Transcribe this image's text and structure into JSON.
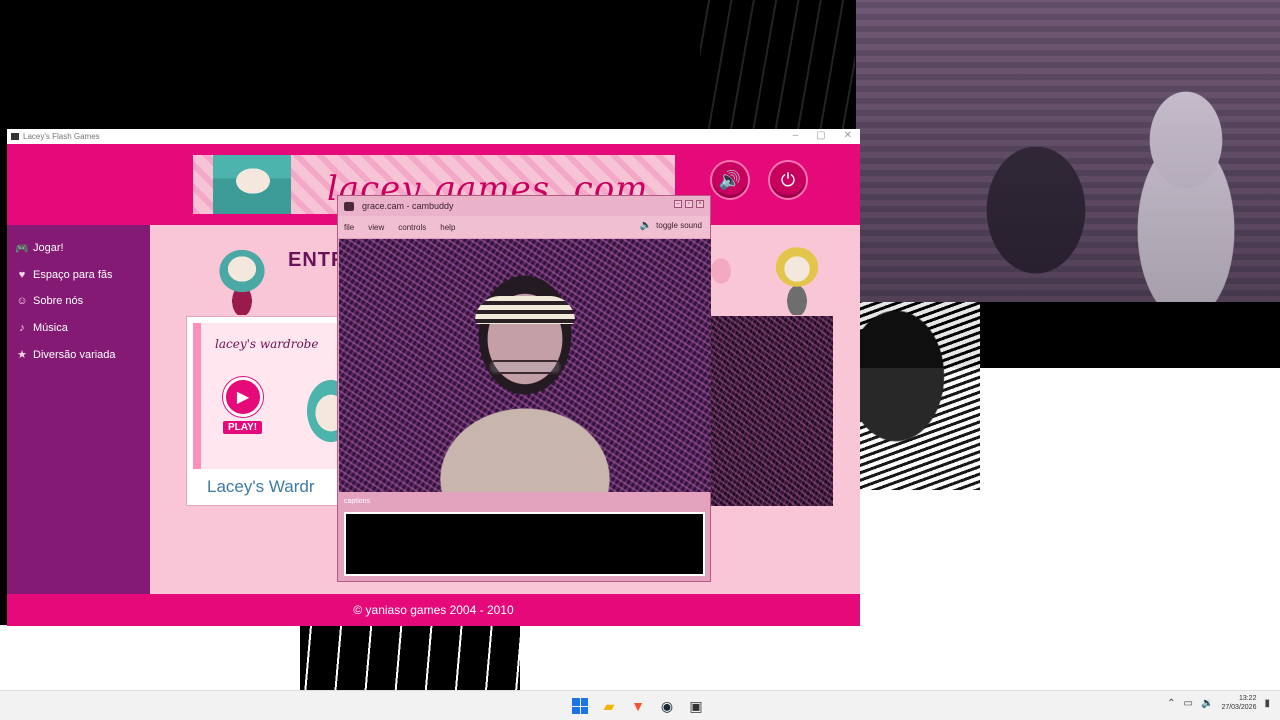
{
  "game_window": {
    "title": "Lacey's Flash Games",
    "banner_logo": "lacey games .com",
    "sound_icon": "speaker-icon",
    "power_icon": "power-icon",
    "nav": [
      {
        "label": "Jogar!",
        "icon": "gamepad-icon"
      },
      {
        "label": "Espaço para fãs",
        "icon": "fans-icon"
      },
      {
        "label": "Sobre nós",
        "icon": "info-icon"
      },
      {
        "label": "Música",
        "icon": "music-icon"
      },
      {
        "label": "Diversão variada",
        "icon": "star-icon"
      }
    ],
    "content_heading": "ENTR",
    "card": {
      "script_title": "lacey's wardrobe",
      "play_label": "PLAY!",
      "name": "Lacey's Wardr"
    },
    "footer": "© yaniaso games 2004 - 2010"
  },
  "popup": {
    "title": "grace.cam - cambuddy",
    "menu": [
      "file",
      "view",
      "controls",
      "help"
    ],
    "toggle_sound": "toggle sound",
    "captions_label": "captions"
  },
  "taskbar": {
    "time": "13:22",
    "date": "27/03/2026",
    "apps": [
      "windows-start-icon",
      "file-explorer-icon",
      "brave-browser-icon",
      "steam-icon",
      "game-app-icon"
    ]
  }
}
